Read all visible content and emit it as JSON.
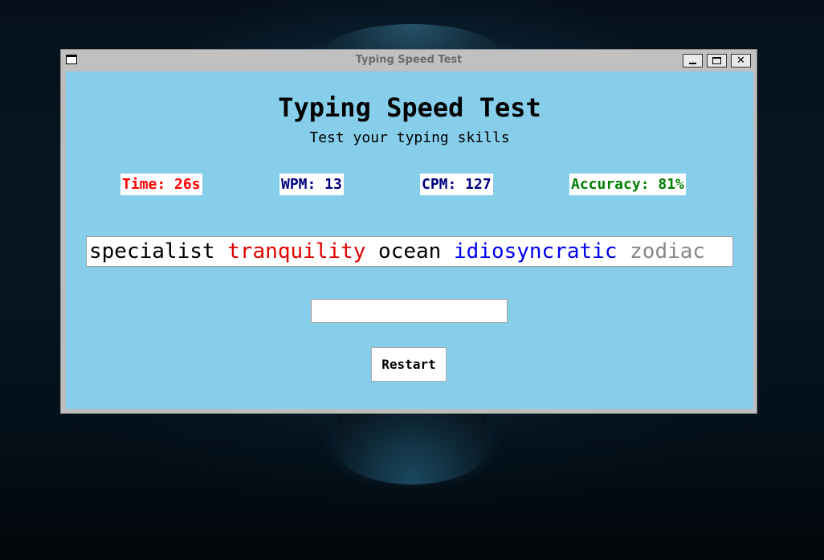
{
  "window": {
    "title": "Typing Speed Test"
  },
  "app": {
    "heading": "Typing Speed Test",
    "subheading": "Test your typing skills"
  },
  "stats": {
    "time": "Time: 26s",
    "wpm": "WPM: 13",
    "cpm": "CPM: 127",
    "accuracy": "Accuracy: 81%"
  },
  "words": [
    {
      "text": "specialist",
      "state": "correct",
      "color": "#000000"
    },
    {
      "text": "tranquility",
      "state": "incorrect",
      "color": "#e00000"
    },
    {
      "text": "ocean",
      "state": "correct",
      "color": "#000000"
    },
    {
      "text": "idiosyncratic",
      "state": "current",
      "color": "#0000ee"
    },
    {
      "text": "zodiac",
      "state": "upcoming",
      "color": "#888888"
    }
  ],
  "input": {
    "value": "",
    "placeholder": ""
  },
  "restart_label": "Restart",
  "colors": {
    "background": "#87ceeb",
    "time": "#ff0000",
    "wpm": "#000080",
    "cpm": "#000080",
    "accuracy": "#008000"
  },
  "icons": {
    "window_icon": "window-icon",
    "minimize": "minimize-icon",
    "maximize": "maximize-icon",
    "close": "close-icon"
  }
}
